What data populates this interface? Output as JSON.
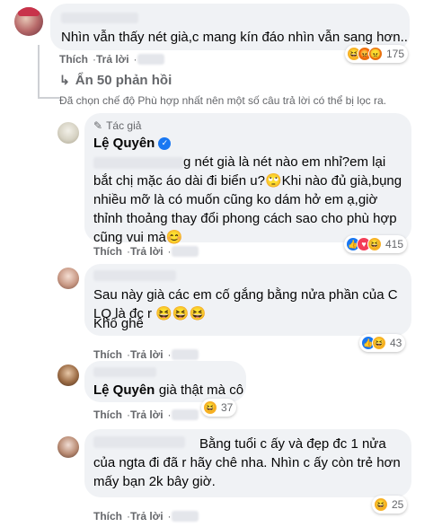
{
  "comments": [
    {
      "text": "Nhìn vẫn thấy nét già,c mang kín đáo nhìn vẫn sang hơn..",
      "actions": {
        "like": "Thích",
        "reply": "Trả lời"
      },
      "reactions": {
        "icons": [
          "haha-icon",
          "angry-icon",
          "angry-icon"
        ],
        "count": "175"
      }
    }
  ],
  "replies_toggle": "Ẩn 50 phản hồi",
  "filter_notice": "Đã chọn chế độ Phù hợp nhất nên một số câu trả lời có thể bị lọc ra.",
  "author_reply": {
    "badge": "Tác giả",
    "name": "Lệ Quyên",
    "text_start": "g nét già là nét nào em nhỉ?em lại bắt",
    "text_rest": "chị mặc áo dài đi biển u?🙄Khi nào đủ già,bụng nhiều mỡ là có muốn cũng ko dám hở em ạ,giờ thỉnh thoảng thay đổi phong cách sao cho phù hợp cũng vui mà😊",
    "actions": {
      "like": "Thích",
      "reply": "Trả lời"
    },
    "reactions": {
      "count": "415"
    }
  },
  "reply2": {
    "text": "Sau này già các em cố gắng bằng nửa phần của C LQ là đc r 😆😆😆",
    "text2": "Khổ ghê",
    "actions": {
      "like": "Thích",
      "reply": "Trả lời"
    },
    "reactions": {
      "count": "43"
    }
  },
  "reply3": {
    "name": "Lệ Quyên",
    "text": "già thật mà cô",
    "actions": {
      "like": "Thích",
      "reply": "Trả lời"
    },
    "reactions": {
      "count": "37"
    }
  },
  "reply4": {
    "text": "Bằng tuổi c ấy và đẹp đc 1 nửa của ngta đi đã r hãy chê nha. Nhìn c ấy còn trẻ hơn mấy bạn 2k bây giờ.",
    "actions": {
      "like": "Thích",
      "reply": "Trả lời"
    },
    "reactions": {
      "count": "25"
    }
  },
  "colors": {
    "link": "#65676b",
    "verified": "#1877f2",
    "bubble": "#f0f2f5"
  }
}
